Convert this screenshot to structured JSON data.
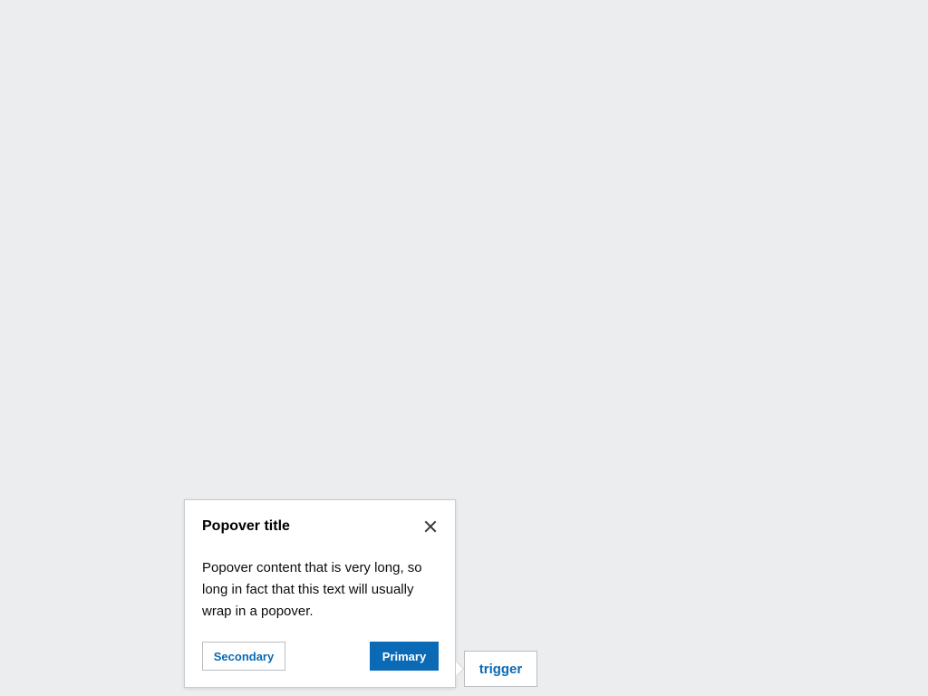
{
  "popover": {
    "title": "Popover title",
    "body": "Popover content that is very long, so long in fact that this text will usually wrap in a popover.",
    "close_icon": "close-icon",
    "secondary_label": "Secondary",
    "primary_label": "Primary"
  },
  "trigger": {
    "label": "trigger"
  },
  "colors": {
    "background": "#ecedee",
    "accent": "#0b6ab5",
    "border": "#c8cbcf"
  }
}
